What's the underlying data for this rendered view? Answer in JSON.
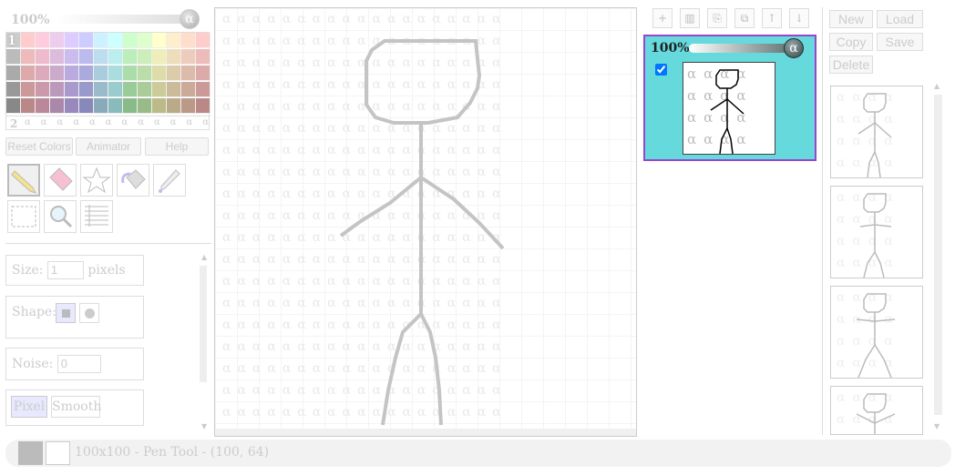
{
  "opacity": {
    "main": "100%",
    "layer": "100%",
    "alpha_glyph": "α"
  },
  "palette": {
    "row1_label": "1",
    "row2_label": "2",
    "colors": [
      [
        "#cccccc",
        "#ffcccc",
        "#ffccdd",
        "#eeccee",
        "#ddccff",
        "#ccccff",
        "#ccf2ff",
        "#ccffff",
        "#ccffcc",
        "#ddffcc",
        "#ffffcc",
        "#ffeecc",
        "#ffddcc",
        "#ffcccc"
      ],
      [
        "#bbbbbb",
        "#eebbbb",
        "#eebbcc",
        "#ddbbdd",
        "#ccbbee",
        "#bbbbee",
        "#bbddee",
        "#bbeeee",
        "#bbeebb",
        "#cceebb",
        "#eeeebb",
        "#eeddbb",
        "#eeccbb",
        "#eebbbb"
      ],
      [
        "#aaaaaa",
        "#ddaaaa",
        "#ddaabb",
        "#ccaacc",
        "#bbaadd",
        "#aaaadd",
        "#aaccdd",
        "#aadddd",
        "#aaddaa",
        "#bbddaa",
        "#ddddaa",
        "#ddccaa",
        "#ddbbaa",
        "#ddaaaa"
      ],
      [
        "#999999",
        "#cc9999",
        "#cc99aa",
        "#bb99bb",
        "#aa99cc",
        "#9999cc",
        "#99bbcc",
        "#99cccc",
        "#99cc99",
        "#aacc99",
        "#cccc99",
        "#ccbb99",
        "#ccaa99",
        "#cc9999"
      ],
      [
        "#888888",
        "#bb8888",
        "#bb8899",
        "#aa88aa",
        "#9988bb",
        "#8888bb",
        "#88aabb",
        "#88bbbb",
        "#88bb88",
        "#99bb88",
        "#bbbb88",
        "#bbaa88",
        "#bb9988",
        "#bb8888"
      ]
    ]
  },
  "menu": {
    "reset": "Reset Colors",
    "animator": "Animator",
    "help": "Help"
  },
  "tools": [
    {
      "name": "pencil-icon",
      "glyph": "✎"
    },
    {
      "name": "eraser-icon",
      "glyph": "▱"
    },
    {
      "name": "star-icon",
      "glyph": "☆"
    },
    {
      "name": "bucket-icon",
      "glyph": "⛾"
    },
    {
      "name": "eyedropper-icon",
      "glyph": "⚲"
    },
    {
      "name": "select-icon",
      "glyph": "⬚"
    },
    {
      "name": "zoom-icon",
      "glyph": "🔍"
    },
    {
      "name": "list-icon",
      "glyph": "☰"
    }
  ],
  "options": {
    "size_label": "Size:",
    "size_value": "1",
    "size_unit": "pixels",
    "shape_label": "Shape:",
    "noise_label": "Noise:",
    "noise_value": "0",
    "pixel": "Pixel",
    "smooth": "Smooth"
  },
  "status": "100x100 - Pen Tool - (100, 64)",
  "layer_toolbar": [
    {
      "name": "add-layer-icon",
      "glyph": "+"
    },
    {
      "name": "layer-columns-icon",
      "glyph": "▥"
    },
    {
      "name": "layer-merge-icon",
      "glyph": "⎘"
    },
    {
      "name": "layer-duplicate-icon",
      "glyph": "⧉"
    },
    {
      "name": "layer-up-icon",
      "glyph": "↑"
    },
    {
      "name": "layer-down-icon",
      "glyph": "↓"
    }
  ],
  "frame_buttons": {
    "new": "New",
    "load": "Load",
    "copy": "Copy",
    "save": "Save",
    "delete": "Delete"
  },
  "colors": {
    "layer_selected_bg": "#66d9dd",
    "layer_selected_border": "#9944cc",
    "primary": "#bbbbbb",
    "secondary": "#ffffff"
  }
}
